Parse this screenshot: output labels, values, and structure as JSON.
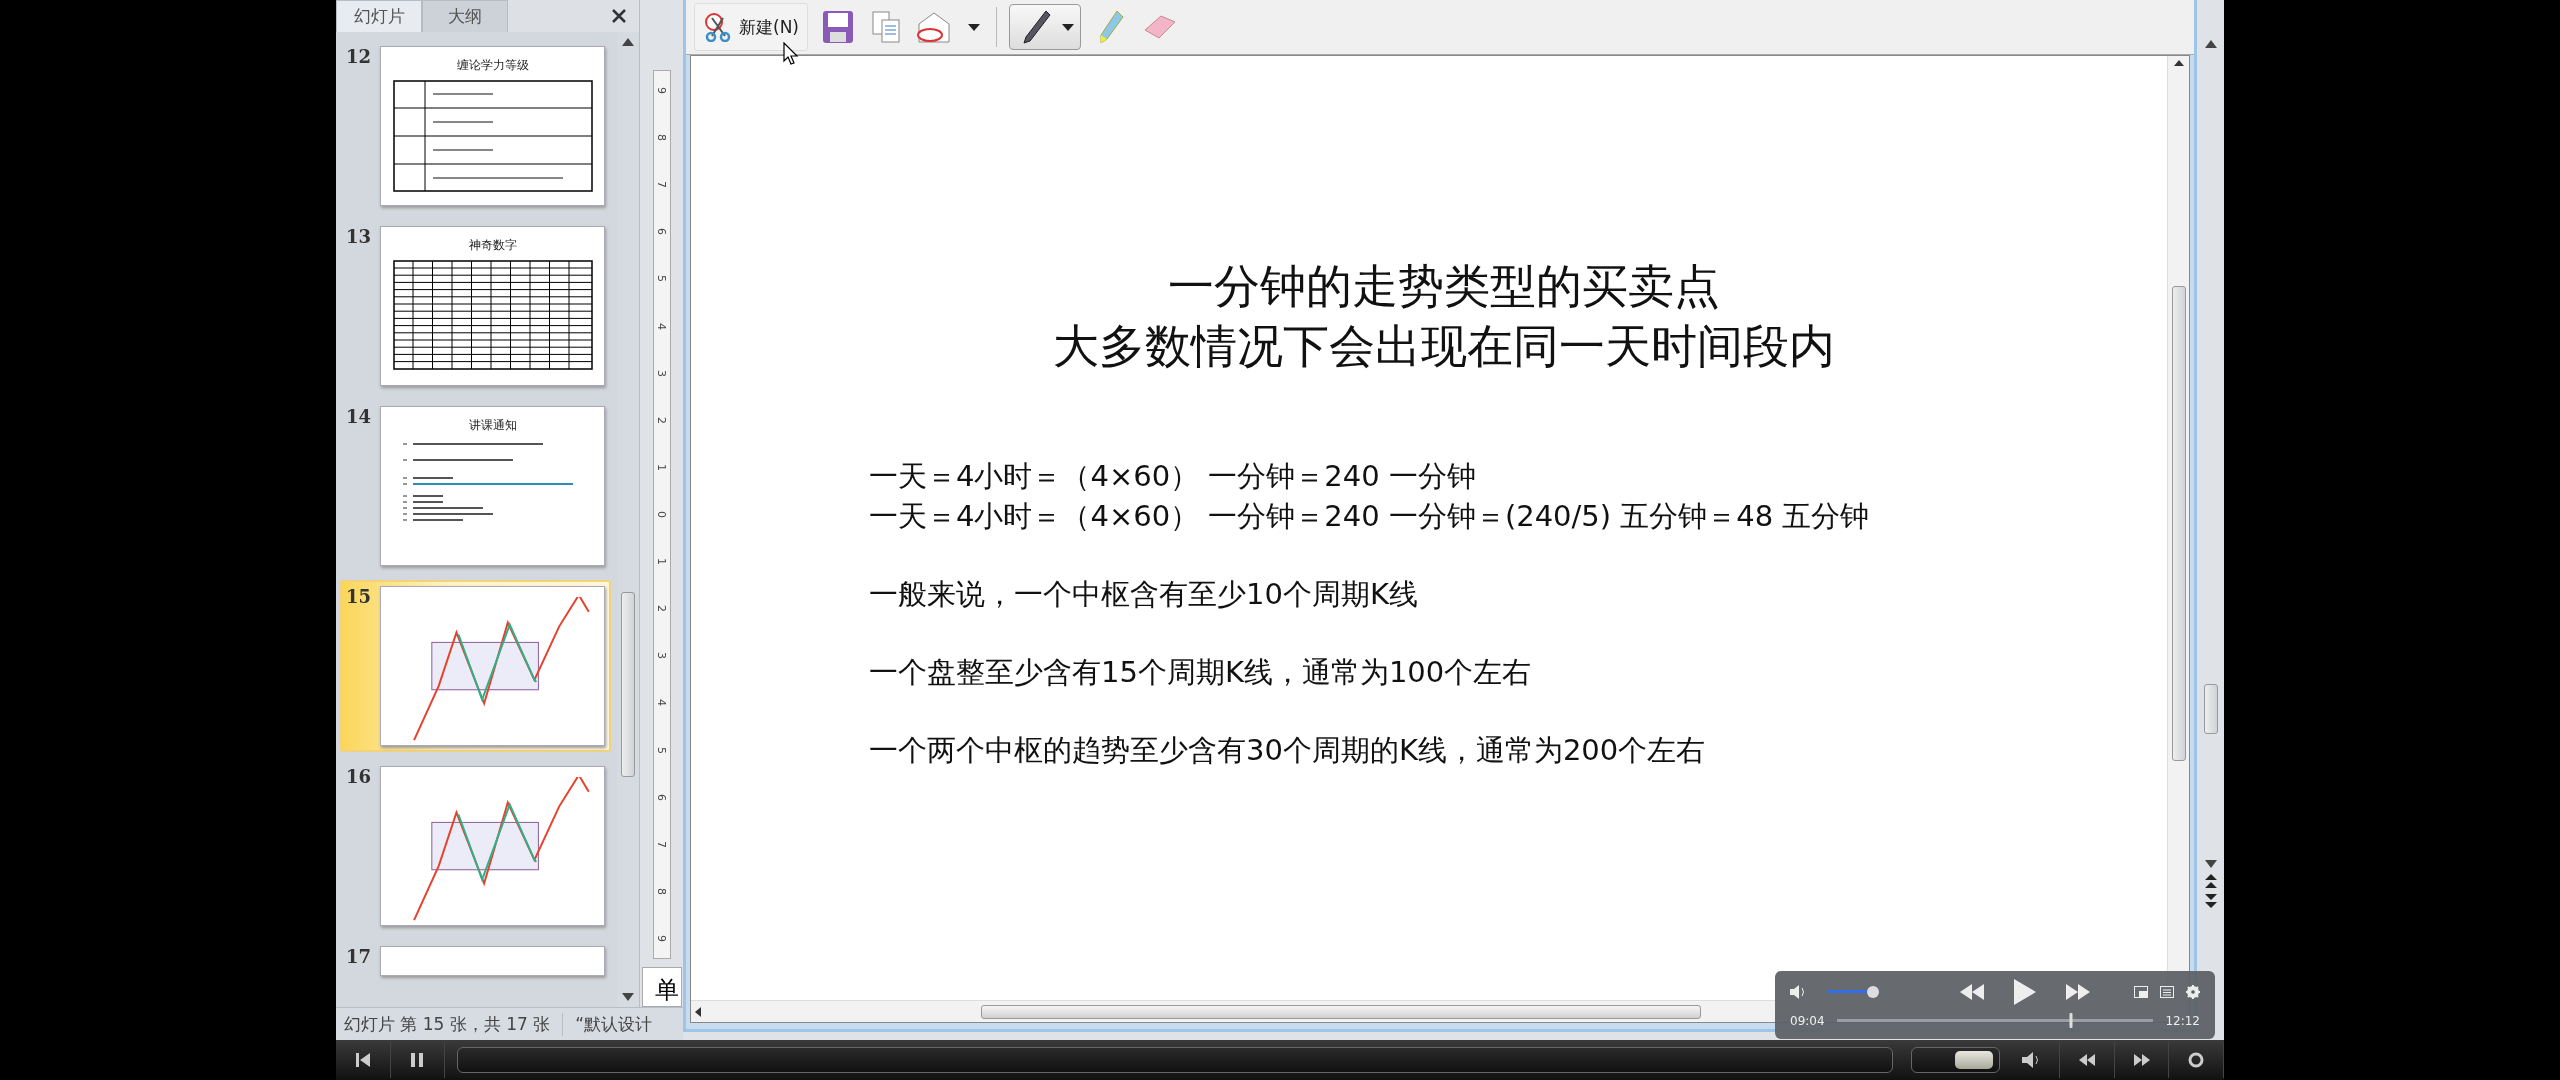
{
  "sidebar": {
    "tabs": [
      {
        "label": "幻灯片",
        "selected": true
      },
      {
        "label": "大纲",
        "selected": false
      }
    ],
    "slides": [
      {
        "number": "12",
        "title": "缠论学力等级",
        "kind": "table",
        "selected": false
      },
      {
        "number": "13",
        "title": "神奇数字",
        "kind": "grid",
        "selected": false
      },
      {
        "number": "14",
        "title": "讲课通知",
        "kind": "notice",
        "selected": false
      },
      {
        "number": "15",
        "kind": "chart",
        "selected": true
      },
      {
        "number": "16",
        "kind": "chart",
        "selected": false
      },
      {
        "number": "17",
        "kind": "partial",
        "selected": false
      }
    ]
  },
  "ruler": {
    "labels": [
      "9",
      "8",
      "7",
      "6",
      "5",
      "4",
      "3",
      "2",
      "1",
      "0",
      "1",
      "2",
      "3",
      "4",
      "5",
      "6",
      "7",
      "8",
      "9"
    ]
  },
  "notes": {
    "text": "单"
  },
  "status_bar": {
    "slide_info": "幻灯片 第 15 张，共 17 张",
    "theme": "“默认设计"
  },
  "toolbar": {
    "new_button": "新建(N)"
  },
  "slide": {
    "title_lines": [
      "一分钟的走势类型的买卖点",
      "大多数情况下会出现在同一天时间段内"
    ],
    "paragraphs": [
      [
        "一天＝4小时＝（4×60）  一分钟＝240   一分钟",
        "一天＝4小时＝（4×60）  一分钟＝240   一分钟＝(240/5)   五分钟＝48   五分钟"
      ],
      [
        "一般来说，一个中枢含有至少10个周期K线"
      ],
      [
        "一个盘整至少含有15个周期K线，通常为100个左右"
      ],
      [
        "一个两个中枢的趋势至少含有30个周期的K线，通常为200个左右"
      ]
    ]
  },
  "player": {
    "volume": {
      "level": 1.0
    },
    "elapsed": "09:04",
    "total": "12:12",
    "progress": {
      "level": 0.74
    }
  },
  "bottom_bar": {
    "slider": {
      "level": 0.72
    }
  }
}
